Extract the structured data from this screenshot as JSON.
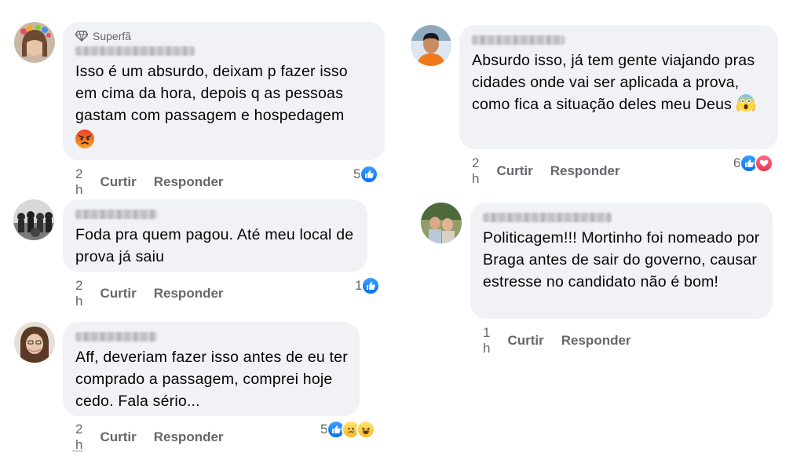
{
  "comments": [
    {
      "badge": "Superfã",
      "text": "Isso é um absurdo, deixam p fazer isso em cima da hora, depois q as pessoas gastam com passagem e hospedagem",
      "emoji": "angry-face",
      "time": "2 h",
      "like": "Curtir",
      "reply": "Responder",
      "reaction_count": "5",
      "reactions": [
        "like"
      ]
    },
    {
      "text": "Foda pra quem pagou. Até meu local de prova já saiu",
      "time": "2 h",
      "like": "Curtir",
      "reply": "Responder",
      "reaction_count": "1",
      "reactions": [
        "like"
      ]
    },
    {
      "text": "Aff, deveriam fazer isso antes de eu ter comprado a passagem, comprei hoje cedo. Fala sério...",
      "time": "2 h",
      "like": "Curtir",
      "reply": "Responder",
      "reaction_count": "5",
      "reactions": [
        "like",
        "sad",
        "haha"
      ]
    },
    {
      "text": "Absurdo isso, já tem gente viajando pras cidades onde vai ser aplicada a prova, como fica a situação deles meu Deus",
      "emoji": "screaming-face",
      "time": "2 h",
      "like": "Curtir",
      "reply": "Responder",
      "reaction_count": "6",
      "reactions": [
        "like",
        "love"
      ]
    },
    {
      "text": "Politicagem!!! Mortinho foi nomeado por Braga antes de sair do governo, causar estresse no candidato não é bom!",
      "time": "1 h",
      "like": "Curtir",
      "reply": "Responder",
      "reaction_count": "",
      "reactions": []
    }
  ],
  "colors": {
    "bubble": "#f0f2f5",
    "meta_text": "#65676b",
    "like_blue": "#1877f2",
    "love_red": "#e8384f"
  },
  "icons": {
    "badge": "diamond-icon",
    "like": "thumbs-up-icon",
    "love": "heart-icon",
    "sad": "sad-face-icon",
    "haha": "laughing-face-icon"
  }
}
